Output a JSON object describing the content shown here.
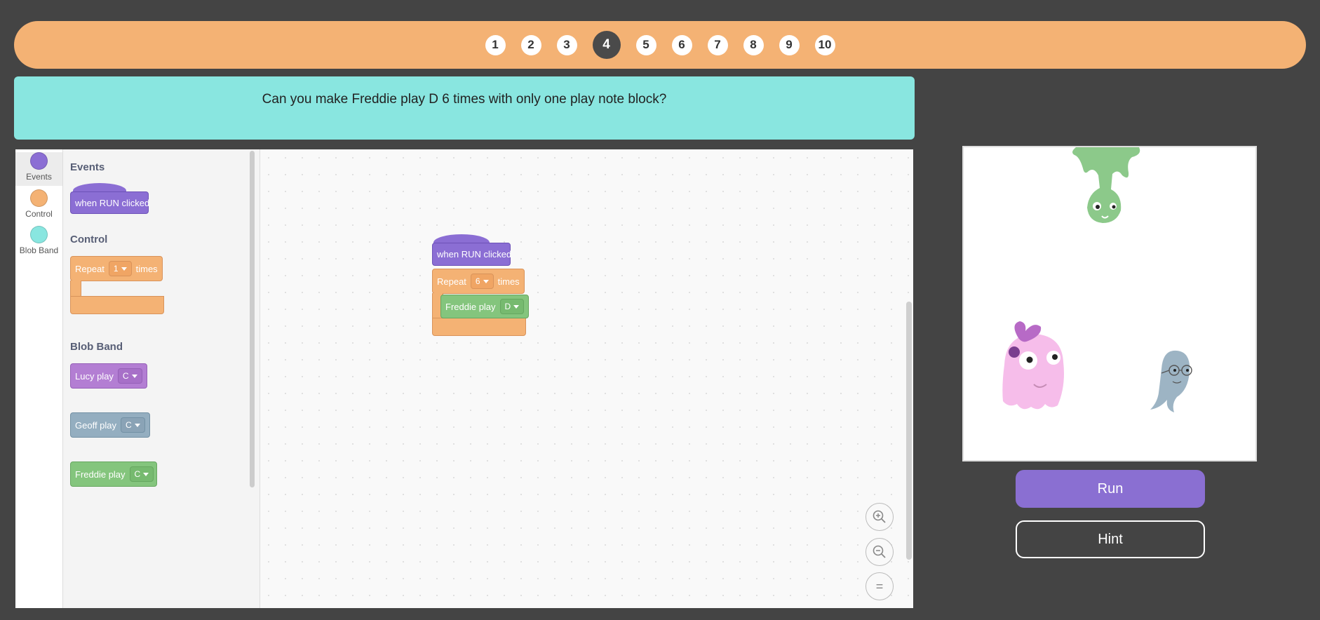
{
  "levels": [
    "1",
    "2",
    "3",
    "4",
    "5",
    "6",
    "7",
    "8",
    "9",
    "10"
  ],
  "active_level": "4",
  "prompt": "Can you make Freddie play D 6 times with only one play note block?",
  "categories": [
    {
      "label": "Events",
      "color": "#8B6ED4"
    },
    {
      "label": "Control",
      "color": "#F4B274"
    },
    {
      "label": "Blob Band",
      "color": "#89E6E0"
    }
  ],
  "toolbox": {
    "events_heading": "Events",
    "when_run": "when RUN clicked",
    "control_heading": "Control",
    "repeat_label": "Repeat",
    "repeat_value": "1",
    "times_label": "times",
    "blob_heading": "Blob Band",
    "lucy_label": "Lucy play",
    "lucy_note": "C",
    "geoff_label": "Geoff play",
    "geoff_note": "C",
    "freddie_label": "Freddie play",
    "freddie_note": "C"
  },
  "program": {
    "when_run": "when RUN clicked",
    "repeat_label": "Repeat",
    "repeat_value": "6",
    "times_label": "times",
    "freddie_label": "Freddie play",
    "freddie_note": "D"
  },
  "zoom": {
    "in": "+",
    "out": "−",
    "reset": "="
  },
  "buttons": {
    "run": "Run",
    "hint": "Hint"
  },
  "colors": {
    "background": "#444444",
    "level_bar": "#F4B274",
    "prompt": "#89E6E0",
    "run": "#8A6FD2"
  }
}
